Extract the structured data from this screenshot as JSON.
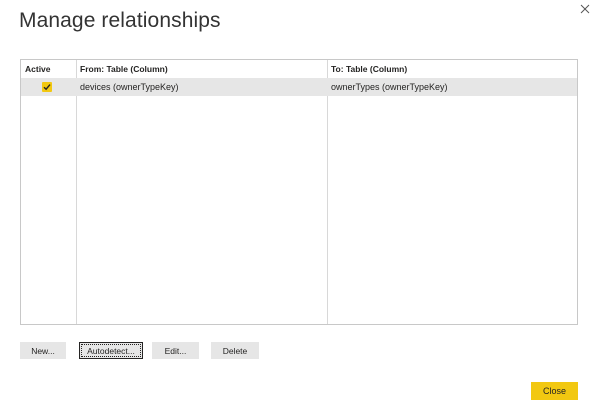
{
  "dialog": {
    "title": "Manage relationships"
  },
  "table": {
    "columns": [
      "Active",
      "From: Table (Column)",
      "To: Table (Column)"
    ],
    "rows": [
      {
        "active": true,
        "from": "devices (ownerTypeKey)",
        "to": "ownerTypes (ownerTypeKey)"
      }
    ]
  },
  "actions": {
    "new_label": "New...",
    "autodetect_label": "Autodetect...",
    "edit_label": "Edit...",
    "delete_label": "Delete"
  },
  "footer": {
    "close_label": "Close"
  },
  "colors": {
    "accent": "#f2c811",
    "selected_row": "#e6e6e6"
  }
}
